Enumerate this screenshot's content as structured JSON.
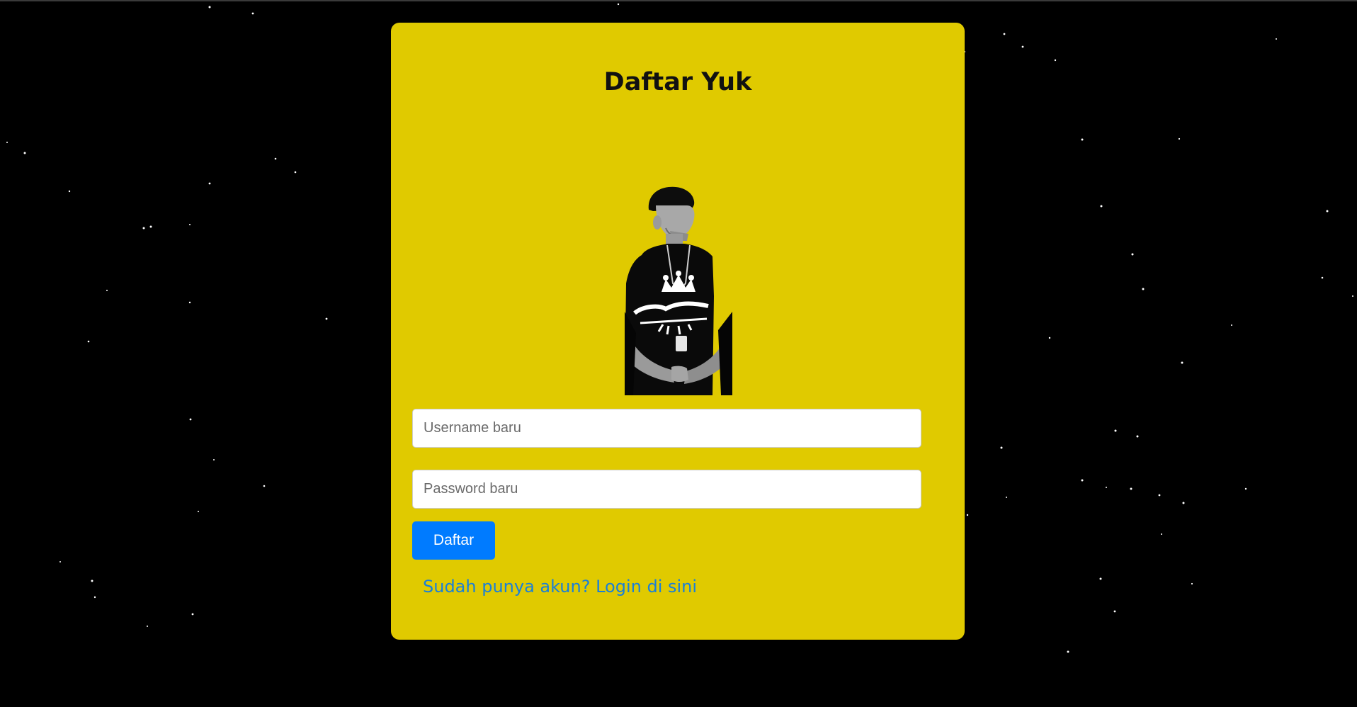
{
  "page": {
    "background_color": "#000000",
    "card_color": "#e0ca00",
    "accent_color": "#007bff",
    "link_color": "#1a7fd8"
  },
  "register_form": {
    "title": "Daftar Yuk",
    "avatar_icon": "person-photo-icon",
    "username_placeholder": "Username baru",
    "username_value": "",
    "password_placeholder": "Password baru",
    "password_value": "",
    "submit_label": "Daftar",
    "login_link_text": "Sudah punya akun? Login di sini"
  }
}
